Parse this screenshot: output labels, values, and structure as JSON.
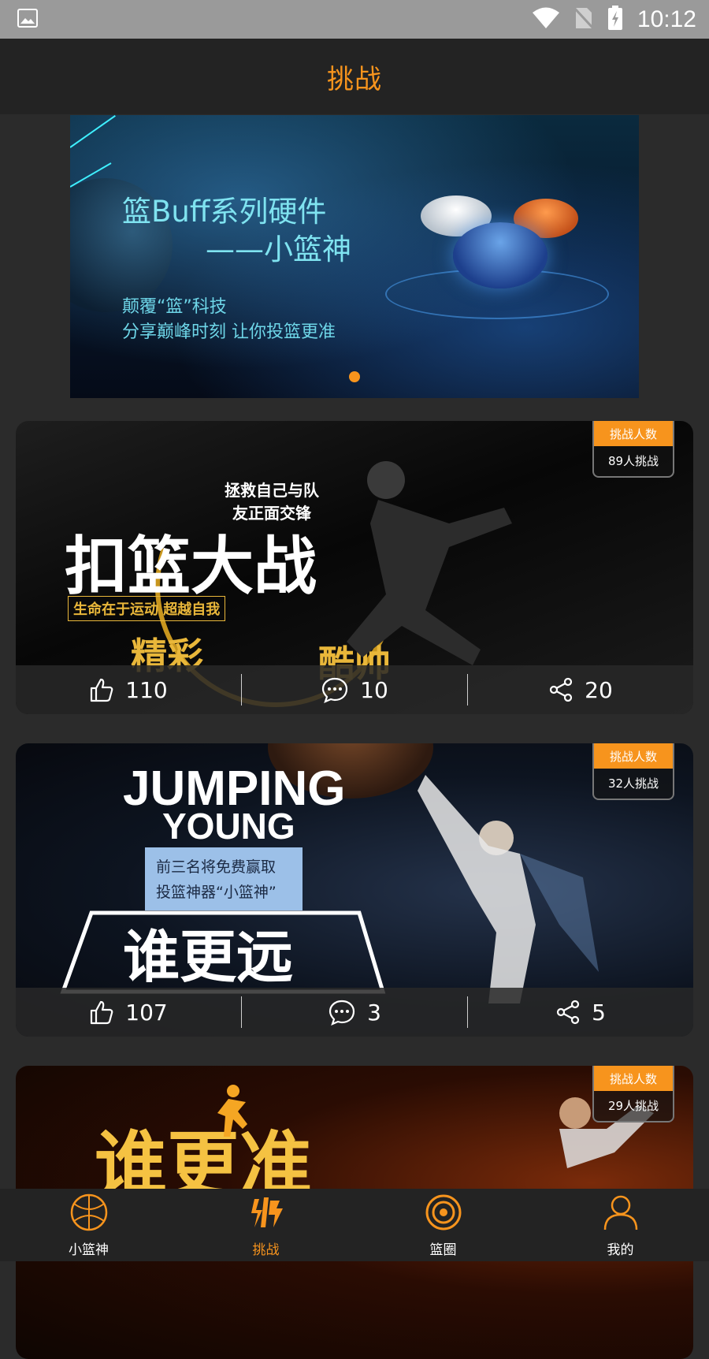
{
  "status_bar": {
    "time": "10:12"
  },
  "header": {
    "title": "挑战"
  },
  "banner": {
    "title": "篮Buff系列硬件",
    "subtitle": "——小篮神",
    "line1": "颠覆“篮”科技",
    "line2": "分享巅峰时刻  让你投篮更准"
  },
  "challenges": [
    {
      "badge_title": "挑战人数",
      "badge_count": "89人挑战",
      "art_title": "扣篮大战",
      "art_tagline": "拯救自己与队友正面交锋",
      "art_slogan": "生命在于运动  超越自我",
      "art_word1": "精彩",
      "art_word2": "酷帅",
      "likes": "110",
      "comments": "10",
      "shares": "20"
    },
    {
      "badge_title": "挑战人数",
      "badge_count": "32人挑战",
      "art_title_en1": "JUMPING",
      "art_title_en2": "YOUNG",
      "art_prize1": "前三名将免费赢取",
      "art_prize2": "投篮神器“小篮神”",
      "art_title": "谁更远",
      "likes": "107",
      "comments": "3",
      "shares": "5"
    },
    {
      "badge_title": "挑战人数",
      "badge_count": "29人挑战",
      "art_title": "谁更准"
    }
  ],
  "bottom_nav": [
    {
      "label": "小篮神",
      "icon": "basketball-icon",
      "active": false
    },
    {
      "label": "挑战",
      "icon": "challenge-icon",
      "active": true
    },
    {
      "label": "篮圈",
      "icon": "circle-target-icon",
      "active": false
    },
    {
      "label": "我的",
      "icon": "person-icon",
      "active": false
    }
  ],
  "colors": {
    "accent": "#f7941d",
    "header_bg": "#232323",
    "page_bg": "#2b2b2b"
  }
}
